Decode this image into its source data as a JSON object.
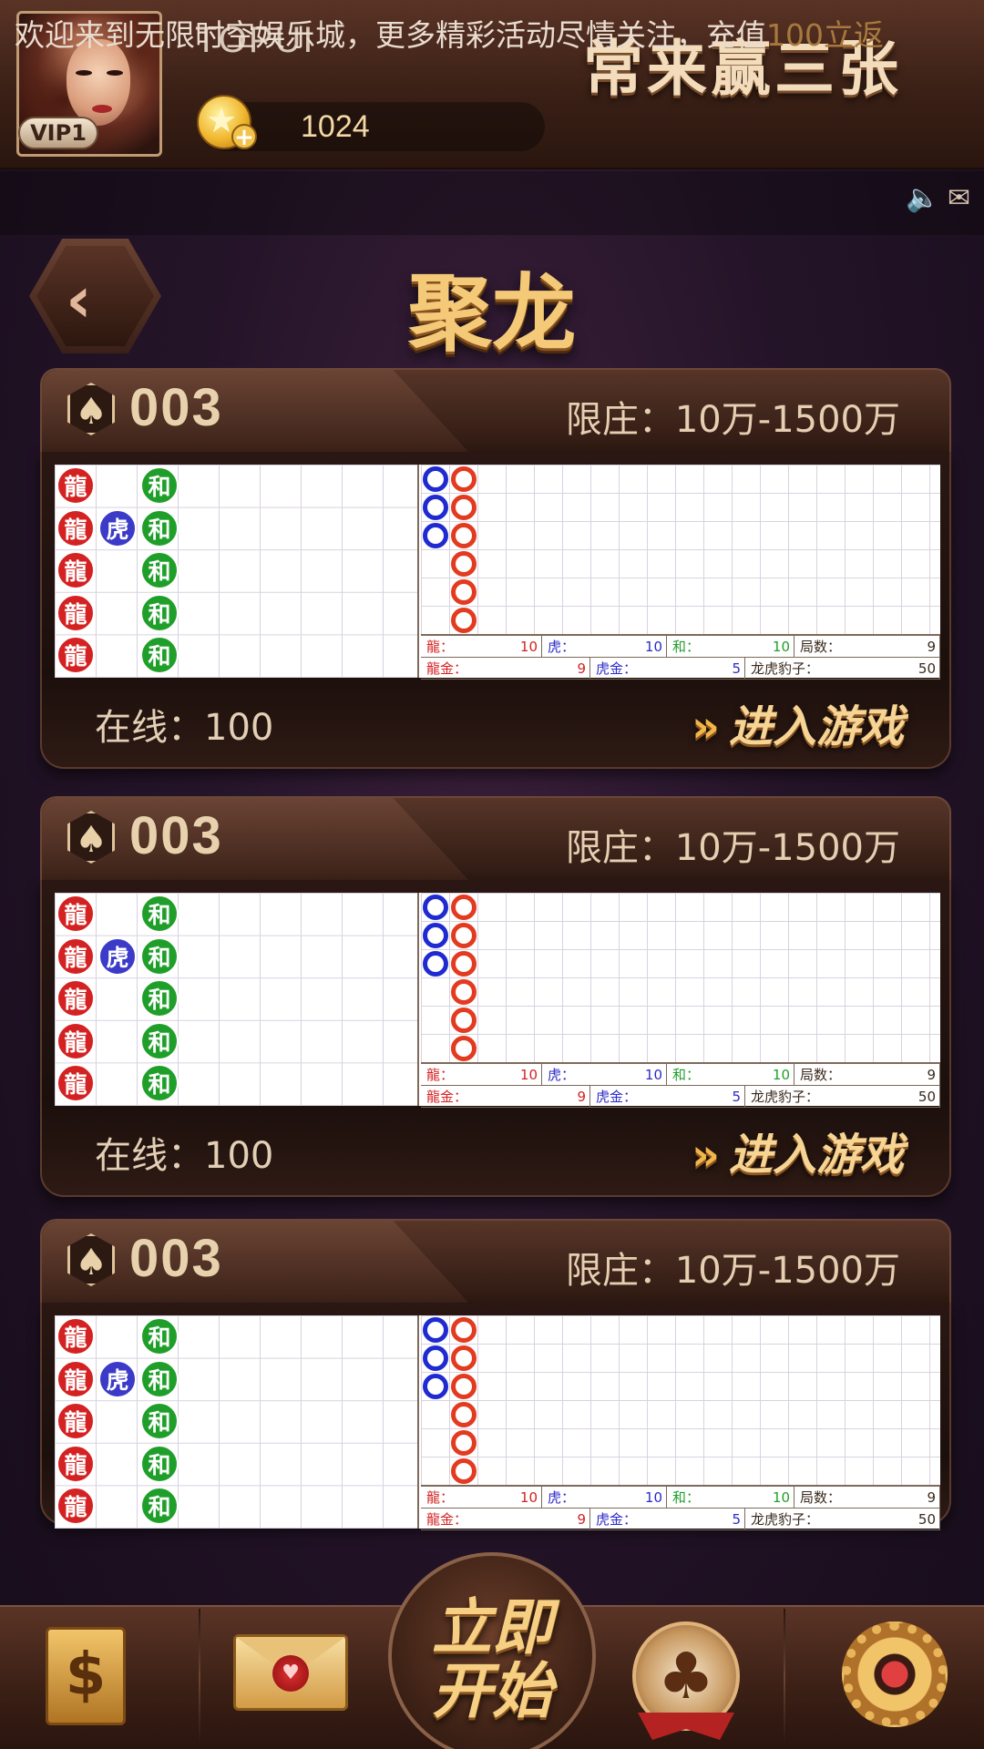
{
  "header": {
    "username": "TOPUI",
    "vip": "VIP1",
    "coins": "1024",
    "brand_title": "常来赢三张"
  },
  "marquee": {
    "text_main": "欢迎来到无限时空娱乐城，更多精彩活动尽情关注，充值",
    "text_highlight": "100立返"
  },
  "page": {
    "title": "聚龙",
    "back_icon": "chevron-left-icon"
  },
  "rooms": [
    {
      "room_no": "003",
      "limit": "限庄：10万-1500万",
      "online": "在线：100",
      "enter": "进入游戏",
      "stats": {
        "dragon_label": "龍：",
        "dragon": "10",
        "tiger_label": "虎：",
        "tiger": "10",
        "tie_label": "和：",
        "tie": "10",
        "rounds_label": "局数：",
        "rounds": "9",
        "dragon_gold_label": "龍金：",
        "dragon_gold": "9",
        "tiger_gold_label": "虎金：",
        "tiger_gold": "5",
        "leopard_label": "龙虎豹子：",
        "leopard": "50"
      }
    },
    {
      "room_no": "003",
      "limit": "限庄：10万-1500万",
      "online": "在线：100",
      "enter": "进入游戏",
      "stats": {
        "dragon_label": "龍：",
        "dragon": "10",
        "tiger_label": "虎：",
        "tiger": "10",
        "tie_label": "和：",
        "tie": "10",
        "rounds_label": "局数：",
        "rounds": "9",
        "dragon_gold_label": "龍金：",
        "dragon_gold": "9",
        "tiger_gold_label": "虎金：",
        "tiger_gold": "5",
        "leopard_label": "龙虎豹子：",
        "leopard": "50"
      }
    },
    {
      "room_no": "003",
      "limit": "限庄：10万-1500万",
      "online": "",
      "enter": "",
      "stats": {
        "dragon_label": "龍：",
        "dragon": "10",
        "tiger_label": "虎：",
        "tiger": "10",
        "tie_label": "和：",
        "tie": "10",
        "rounds_label": "局数：",
        "rounds": "9",
        "dragon_gold_label": "龍金：",
        "dragon_gold": "9",
        "tiger_gold_label": "虎金：",
        "tiger_gold": "5",
        "leopard_label": "龙虎豹子：",
        "leopard": "50"
      }
    }
  ],
  "bead_road": {
    "dragon": "龍",
    "tiger": "虎",
    "tie": "和",
    "col1": [
      "dragon",
      "dragon",
      "dragon",
      "dragon",
      "dragon"
    ],
    "col2": [
      "",
      "tiger",
      "",
      "",
      ""
    ],
    "col3": [
      "tie",
      "tie",
      "tie",
      "tie",
      "tie"
    ]
  },
  "big_road": {
    "blue_col": 3,
    "red_col": 6
  },
  "dock": {
    "start_line1": "立即",
    "start_line2": "开始",
    "safe_icon": "safe-icon",
    "mail_icon": "mail-icon",
    "badge_icon": "club-badge-icon",
    "settings_icon": "gear-icon"
  },
  "colors": {
    "dragon": "#d42121",
    "tiger": "#3b3ac9",
    "tie": "#1f9f2a",
    "gold_text": "#f4c978"
  }
}
